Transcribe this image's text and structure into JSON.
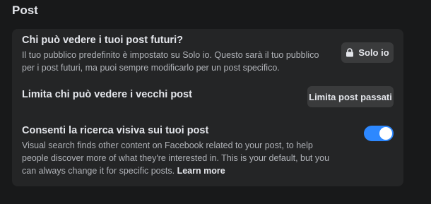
{
  "section": {
    "title": "Post"
  },
  "settings": {
    "future_posts": {
      "title": "Chi può vedere i tuoi post futuri?",
      "description": "Il tuo pubblico predefinito è impostato su Solo io. Questo sarà il tuo pubblico per i post futuri, ma puoi sempre modificarlo per un post specifico.",
      "button_label": "Solo io",
      "button_icon": "lock-icon"
    },
    "old_posts": {
      "title": "Limita chi può vedere i vecchi post",
      "button_label": "Limita post passati"
    },
    "visual_search": {
      "title": "Consenti la ricerca visiva sui tuoi post",
      "description": "Visual search finds other content on Facebook related to your post, to help people discover more of what they're interested in. This is your default, but you can always change it for specific posts.",
      "link_label": "Learn more",
      "toggle_on": true
    }
  },
  "colors": {
    "background": "#18191a",
    "card": "#242526",
    "button": "#3a3b3c",
    "toggle_on": "#2d88ff"
  }
}
